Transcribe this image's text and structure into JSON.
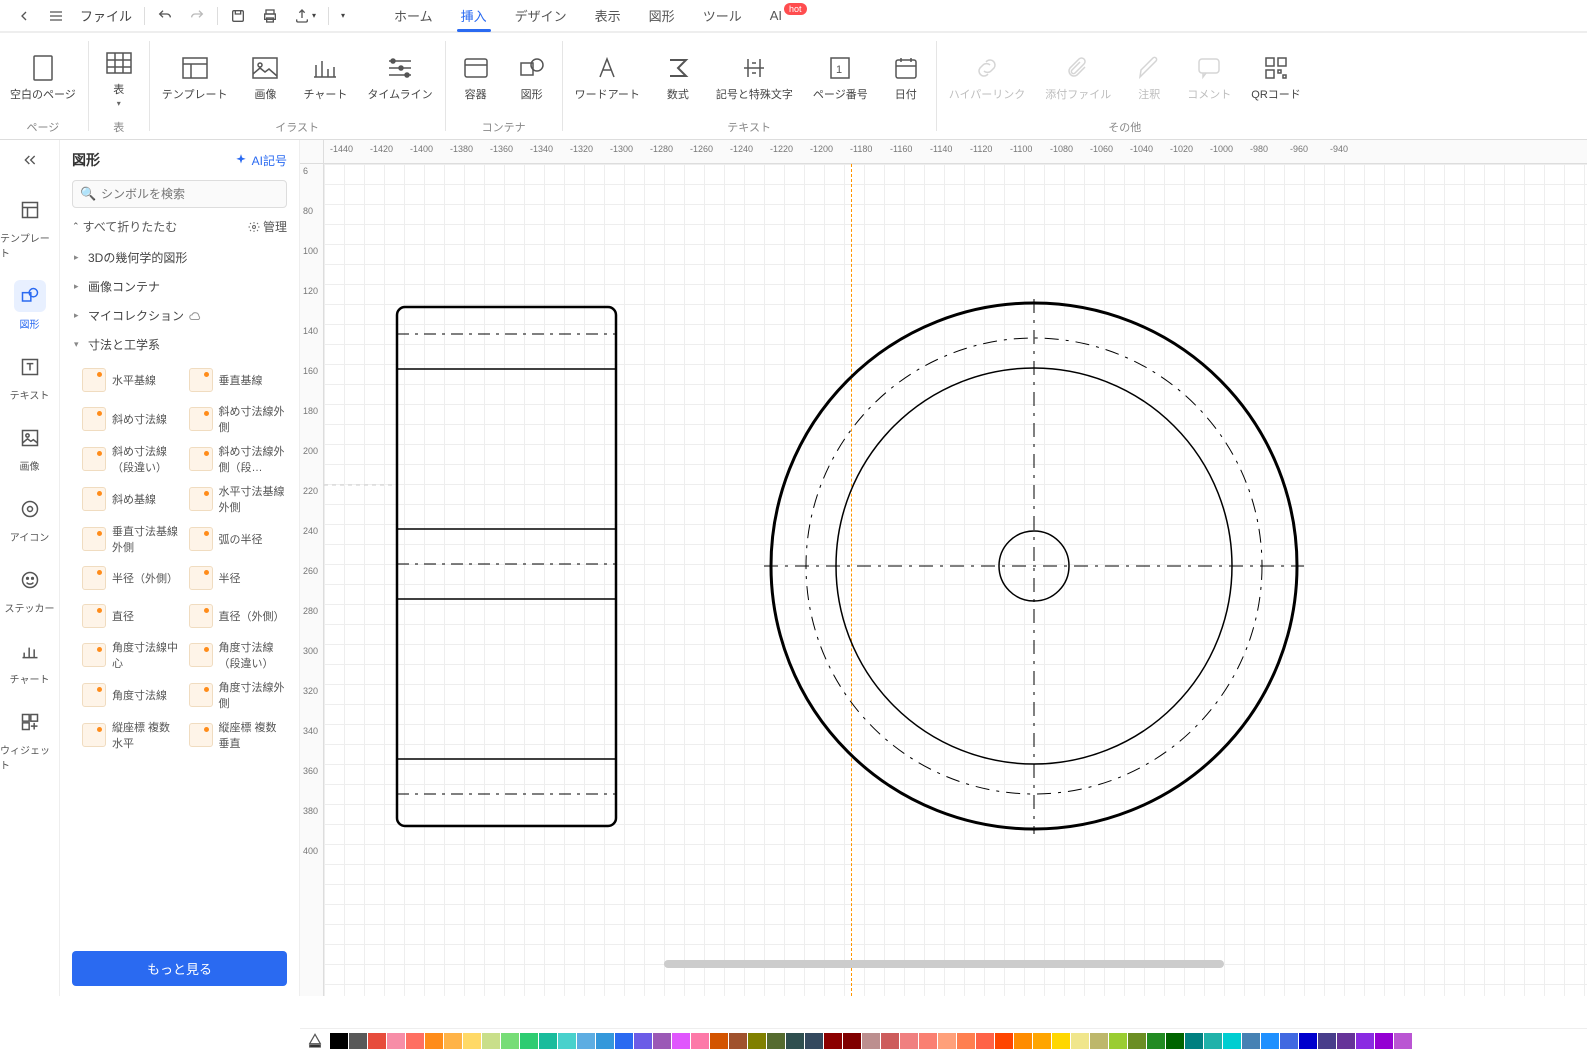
{
  "topbar": {
    "file": "ファイル"
  },
  "tabs": {
    "home": "ホーム",
    "insert": "挿入",
    "design": "デザイン",
    "view": "表示",
    "shape": "図形",
    "tool": "ツール",
    "ai": "AI",
    "hot": "hot"
  },
  "ribbon": {
    "blank_page": "空白のページ",
    "table": "表",
    "template": "テンプレート",
    "image": "画像",
    "chart": "チャート",
    "timeline": "タイムライン",
    "container": "容器",
    "shape": "図形",
    "wordart": "ワードアート",
    "formula": "数式",
    "symbols": "記号と特殊文字",
    "page_number": "ページ番号",
    "date": "日付",
    "hyperlink": "ハイパーリンク",
    "attachment": "添付ファイル",
    "comment": "注釈",
    "note": "コメント",
    "qrcode": "QRコード",
    "group_page": "ページ",
    "group_table": "表",
    "group_illust": "イラスト",
    "group_container": "コンテナ",
    "group_text": "テキスト",
    "group_other": "その他"
  },
  "rail": {
    "template": "テンプレート",
    "shape": "図形",
    "text": "テキスト",
    "image": "画像",
    "icon": "アイコン",
    "sticker": "ステッカー",
    "chart": "チャート",
    "widget": "ウィジェット"
  },
  "panel": {
    "title": "図形",
    "ai_symbol": "AI記号",
    "search_placeholder": "シンボルを検索",
    "collapse_all": "すべて折りたたむ",
    "manage": "管理",
    "see_more": "もっと見る"
  },
  "categories": {
    "geom3d": "3Dの幾何学的図形",
    "image_container": "画像コンテナ",
    "my_collection": "マイコレクション",
    "dimension": "寸法と工学系"
  },
  "shapes": [
    {
      "l": "水平基線",
      "r": "垂直基線"
    },
    {
      "l": "斜め寸法線",
      "r": "斜め寸法線外側"
    },
    {
      "l": "斜め寸法線（段違い）",
      "r": "斜め寸法線外側（段…"
    },
    {
      "l": "斜め基線",
      "r": "水平寸法基線外側"
    },
    {
      "l": "垂直寸法基線外側",
      "r": "弧の半径"
    },
    {
      "l": "半径（外側）",
      "r": "半径"
    },
    {
      "l": "直径",
      "r": "直径（外側）"
    },
    {
      "l": "角度寸法線中心",
      "r": "角度寸法線（段違い）"
    },
    {
      "l": "角度寸法線",
      "r": "角度寸法線外側"
    },
    {
      "l": "縦座標 複数水平",
      "r": "縦座標 複数垂直"
    }
  ],
  "ruler_h": [
    "-1440",
    "-1420",
    "-1400",
    "-1380",
    "-1360",
    "-1340",
    "-1320",
    "-1300",
    "-1280",
    "-1260",
    "-1240",
    "-1220",
    "-1200",
    "-1180",
    "-1160",
    "-1140",
    "-1120",
    "-1100",
    "-1080",
    "-1060",
    "-1040",
    "-1020",
    "-1000",
    "-980",
    "-960",
    "-940"
  ],
  "ruler_v": [
    "6",
    "80",
    "100",
    "120",
    "140",
    "160",
    "180",
    "200",
    "220",
    "240",
    "260",
    "280",
    "300",
    "320",
    "340",
    "360",
    "380",
    "400"
  ],
  "colors": [
    "#000000",
    "#595959",
    "#e74c3c",
    "#f78da7",
    "#ff6f61",
    "#ff8c1a",
    "#ffb347",
    "#ffd966",
    "#c9df8a",
    "#77dd77",
    "#2ecc71",
    "#1abc9c",
    "#48d1cc",
    "#5dade2",
    "#3498db",
    "#2a6af1",
    "#6c5ce7",
    "#9b59b6",
    "#e056fd",
    "#fd79a8",
    "#d35400",
    "#a0522d",
    "#808000",
    "#556b2f",
    "#2f4f4f",
    "#34495e",
    "#8b0000",
    "#800000",
    "#bc8f8f",
    "#cd5c5c",
    "#f08080",
    "#fa8072",
    "#ffa07a",
    "#ff7f50",
    "#ff6347",
    "#ff4500",
    "#ff8c00",
    "#ffa500",
    "#ffd700",
    "#f0e68c",
    "#bdb76b",
    "#9acd32",
    "#6b8e23",
    "#228b22",
    "#006400",
    "#008080",
    "#20b2aa",
    "#00ced1",
    "#4682b4",
    "#1e90ff",
    "#4169e1",
    "#0000cd",
    "#483d8b",
    "#663399",
    "#8a2be2",
    "#9400d3",
    "#ba55d3"
  ]
}
